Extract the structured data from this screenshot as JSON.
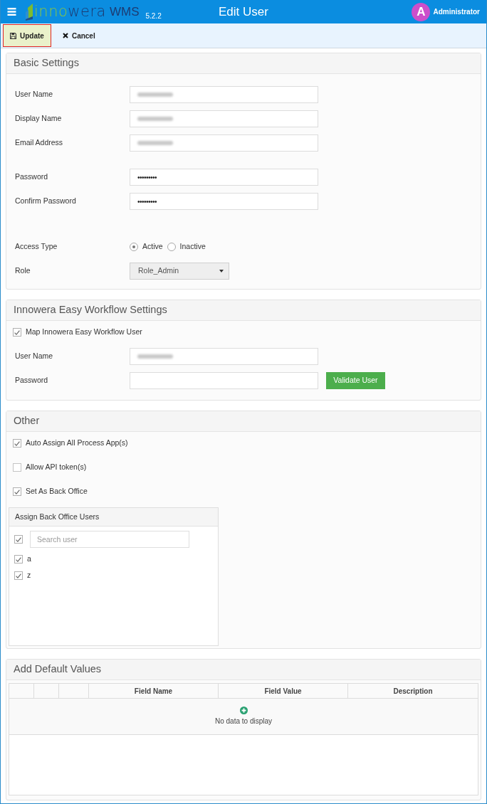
{
  "header": {
    "logo": {
      "wordmark": [
        "inno",
        "wera"
      ],
      "product": "WMS",
      "version": "5.2.2"
    },
    "title": "Edit User",
    "user": {
      "initial": "A",
      "name": "Administrator"
    }
  },
  "toolbar": [
    {
      "label": "Update",
      "focused": true
    },
    {
      "label": "Cancel",
      "focused": false
    }
  ],
  "basic_settings": {
    "title": "Basic Settings",
    "groups": [
      [
        {
          "kind": "text",
          "label": "User Name",
          "redacted": true
        },
        {
          "kind": "text",
          "label": "Display Name",
          "redacted": true
        },
        {
          "kind": "text",
          "label": "Email Address",
          "redacted": true
        }
      ],
      [
        {
          "kind": "text",
          "label": "Password",
          "value": "•••••••••"
        },
        {
          "kind": "text",
          "label": "Confirm Password",
          "value": "•••••••••"
        }
      ],
      [
        {
          "kind": "radio",
          "label": "Access Type",
          "options": [
            {
              "label": "Active",
              "selected": true
            },
            {
              "label": "Inactive",
              "selected": false
            }
          ]
        },
        {
          "kind": "select",
          "label": "Role",
          "value": "Role_Admin"
        }
      ]
    ]
  },
  "workflow_settings": {
    "title": "Innowera Easy Workflow Settings",
    "map_user": {
      "label": "Map Innowera Easy Workflow User",
      "checked": true
    },
    "fields": [
      {
        "kind": "text",
        "label": "User Name",
        "redacted": true
      },
      {
        "kind": "text",
        "label": "Password",
        "action": "Validate User"
      }
    ]
  },
  "other": {
    "title": "Other",
    "options": [
      {
        "label": "Auto Assign All Process App(s)",
        "checked": true
      },
      {
        "label": "Allow API token(s)",
        "checked": false
      },
      {
        "label": "Set As Back Office",
        "checked": true
      }
    ],
    "back_office": {
      "title": "Assign Back Office Users",
      "select_all": {
        "checked": true
      },
      "search": {
        "placeholder": "Search user"
      },
      "users": [
        {
          "name": "a",
          "checked": true
        },
        {
          "name": "z",
          "checked": true
        }
      ]
    }
  },
  "default_values": {
    "title": "Add Default Values",
    "table": {
      "columns": [
        "Field Name",
        "Field Value",
        "Description"
      ],
      "empty_text": "No data to display"
    }
  }
}
